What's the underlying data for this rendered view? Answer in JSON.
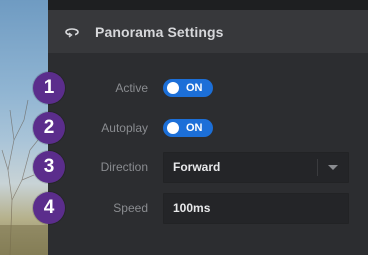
{
  "panel": {
    "title": "Panorama Settings",
    "header_icon": "panorama-rotate-icon"
  },
  "settings": {
    "active": {
      "label": "Active",
      "toggle_text": "ON",
      "checked": true
    },
    "autoplay": {
      "label": "Autoplay",
      "toggle_text": "ON",
      "checked": true
    },
    "direction": {
      "label": "Direction",
      "value": "Forward"
    },
    "speed": {
      "label": "Speed",
      "value": "100ms"
    }
  },
  "callouts": [
    "1",
    "2",
    "3",
    "4"
  ],
  "colors": {
    "accent": "#1c6fd8",
    "badge": "#5b2d8c",
    "panel_bg": "#2c2d30",
    "header_bg": "#37383b"
  }
}
